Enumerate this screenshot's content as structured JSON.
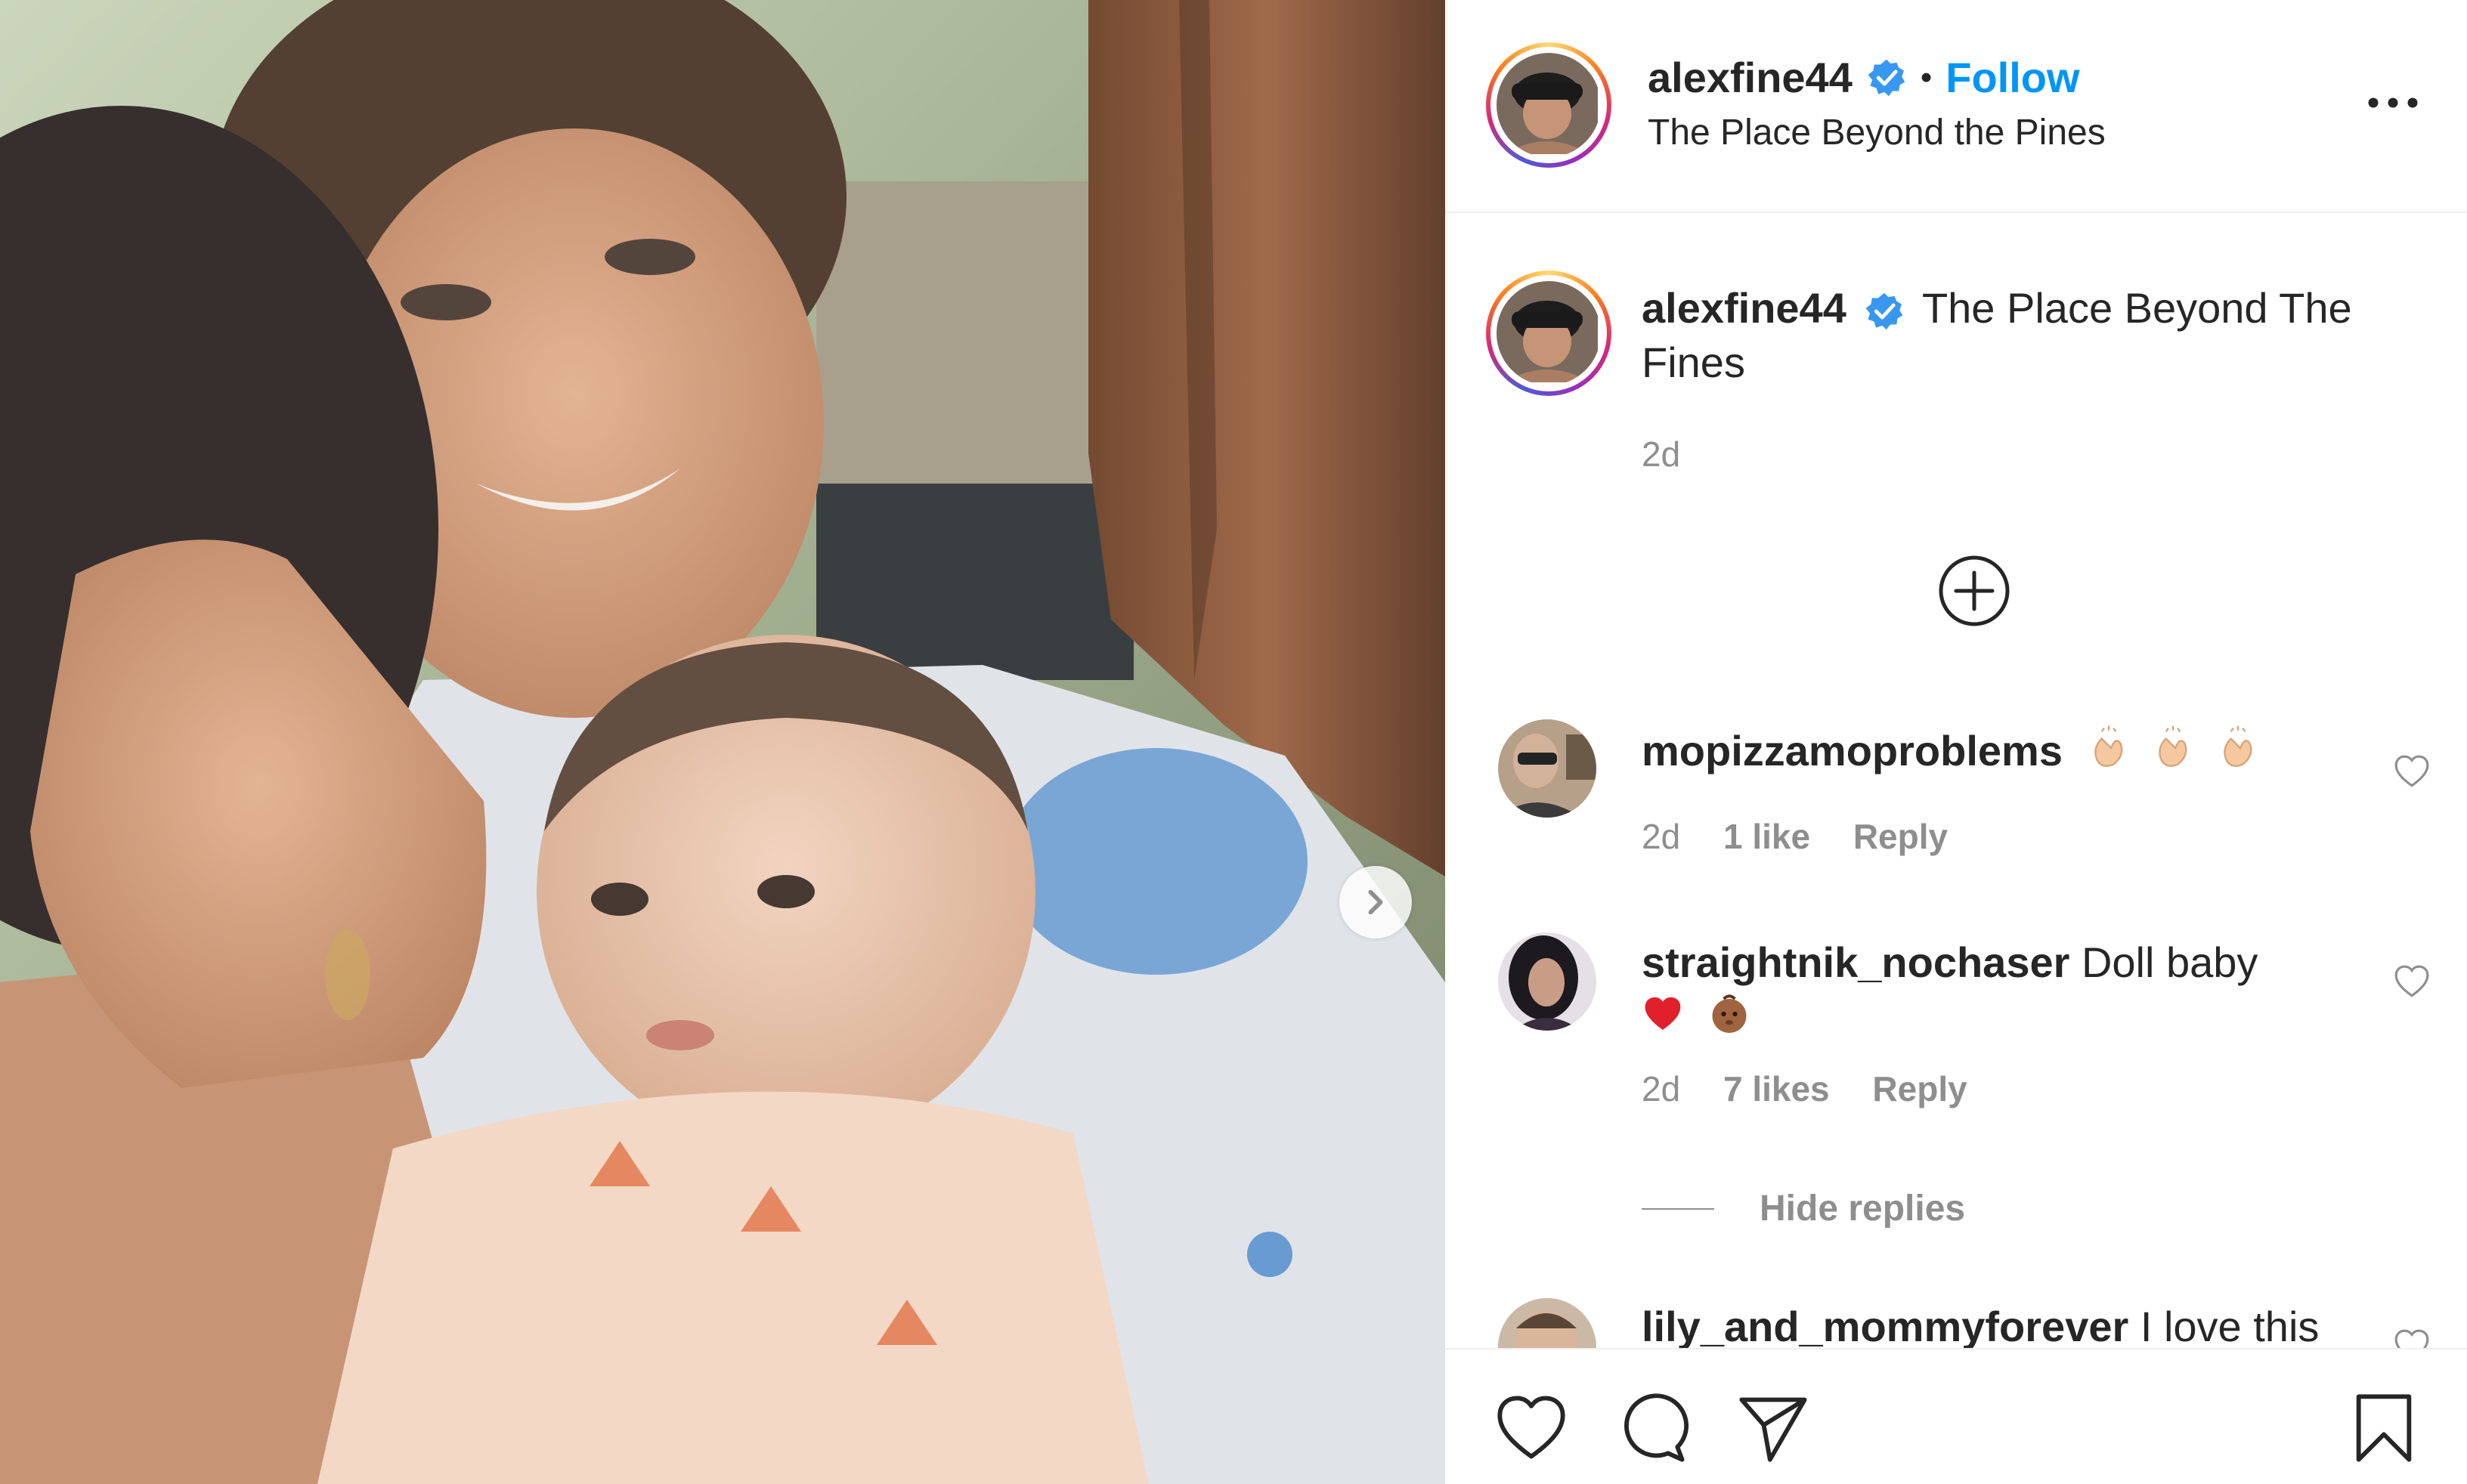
{
  "post": {
    "username": "alexfine44",
    "follow_label": "Follow",
    "separator": "•",
    "location": "The Place Beyond the Pines",
    "more_label": "•••"
  },
  "caption": {
    "username": "alexfine44",
    "text": "The Place Beyond The Fines",
    "time": "2d"
  },
  "comments": [
    {
      "username": "mopizzamoproblems",
      "text": "",
      "emojis": [
        "clapping-hands-emoji",
        "clapping-hands-emoji",
        "clapping-hands-emoji"
      ],
      "time": "2d",
      "likes": "1 like",
      "reply": "Reply"
    },
    {
      "username": "straightnik_nochaser",
      "text": "Doll baby",
      "emojis": [
        "red-heart-emoji",
        "baby-emoji"
      ],
      "time": "2d",
      "likes": "7 likes",
      "reply": "Reply"
    },
    {
      "username": "lily_and_mommyforever",
      "text": "I love this"
    }
  ],
  "hide_replies": "Hide replies",
  "icons": {
    "verified": "verified-badge-icon",
    "more": "more-options-icon",
    "next": "chevron-right-icon",
    "add": "plus-circle-icon",
    "like": "heart-icon",
    "comment": "comment-bubble-icon",
    "share": "paper-plane-icon",
    "save": "bookmark-icon"
  },
  "colors": {
    "link_blue": "#0095f6",
    "verified_blue": "#3897f0",
    "text": "#262626",
    "muted": "#8e8e8e",
    "divider": "#efefef"
  }
}
